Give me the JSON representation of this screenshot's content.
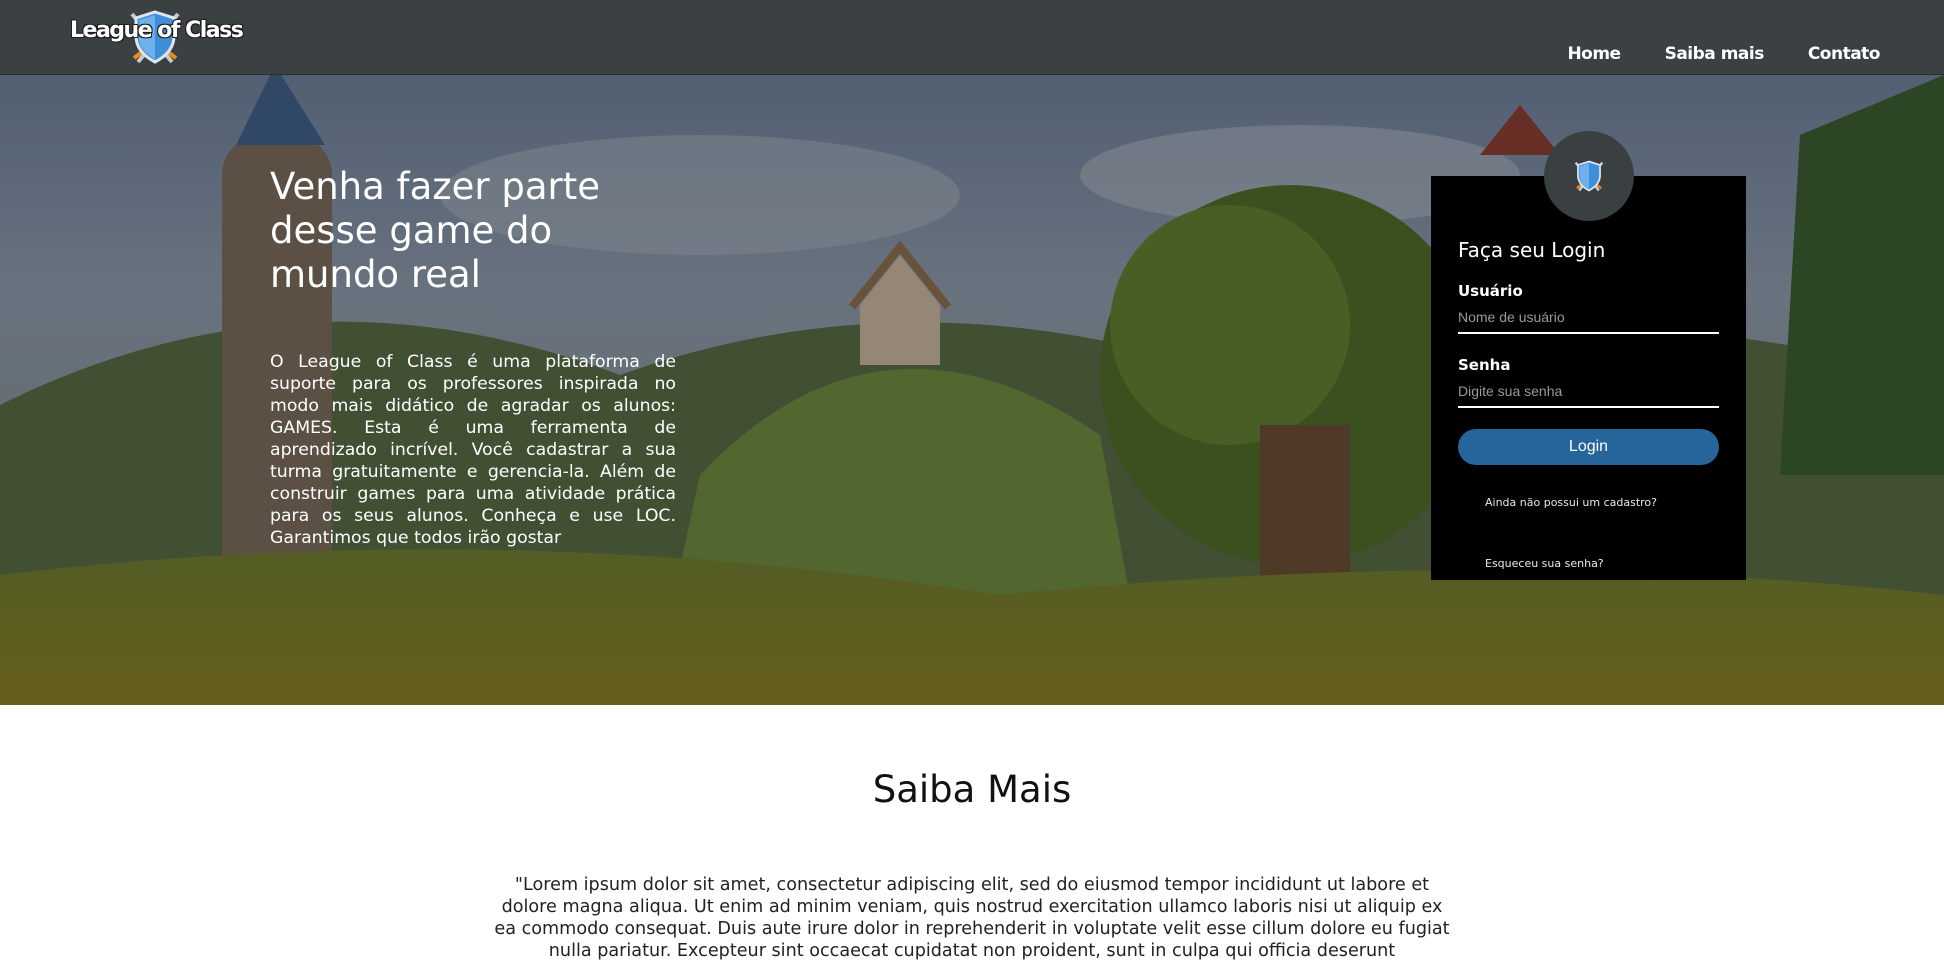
{
  "header": {
    "logo_text": "League of Class",
    "nav": [
      {
        "label": "Home"
      },
      {
        "label": "Saiba mais"
      },
      {
        "label": "Contato"
      }
    ]
  },
  "hero": {
    "title": "Venha fazer parte desse game do mundo real",
    "description": "O League of Class é uma plataforma de suporte para os professores inspirada no modo mais didático de agradar os alunos: GAMES. Esta é uma ferramenta de aprendizado incrível. Você cadastrar a sua turma gratuitamente e gerencia-la. Além de construir games para uma atividade prática para os seus alunos. Conheça e use LOC. Garantimos que todos irão gostar"
  },
  "login": {
    "title": "Faça seu Login",
    "user_label": "Usuário",
    "user_placeholder": "Nome de usuário",
    "password_label": "Senha",
    "password_placeholder": "Digite sua senha",
    "button_label": "Login",
    "register_link": "Ainda não possui um cadastro?",
    "forgot_link": "Esqueceu sua senha?"
  },
  "about": {
    "title": "Saiba Mais",
    "text": "\"Lorem ipsum dolor sit amet, consectetur adipiscing elit, sed do eiusmod tempor incididunt ut labore et dolore magna aliqua. Ut enim ad minim veniam, quis nostrud exercitation ullamco laboris nisi ut aliquip ex ea commodo consequat. Duis aute irure dolor in reprehenderit in voluptate velit esse cillum dolore eu fugiat nulla pariatur. Excepteur sint occaecat cupidatat non proident, sunt in culpa qui officia deserunt"
  },
  "colors": {
    "header_bg": "#3b4143",
    "login_card_bg": "#000000",
    "login_button": "#26649c",
    "avatar_bg": "#3a3f42"
  },
  "icons": {
    "logo": "shield-swords-icon",
    "avatar": "shield-swords-icon"
  }
}
